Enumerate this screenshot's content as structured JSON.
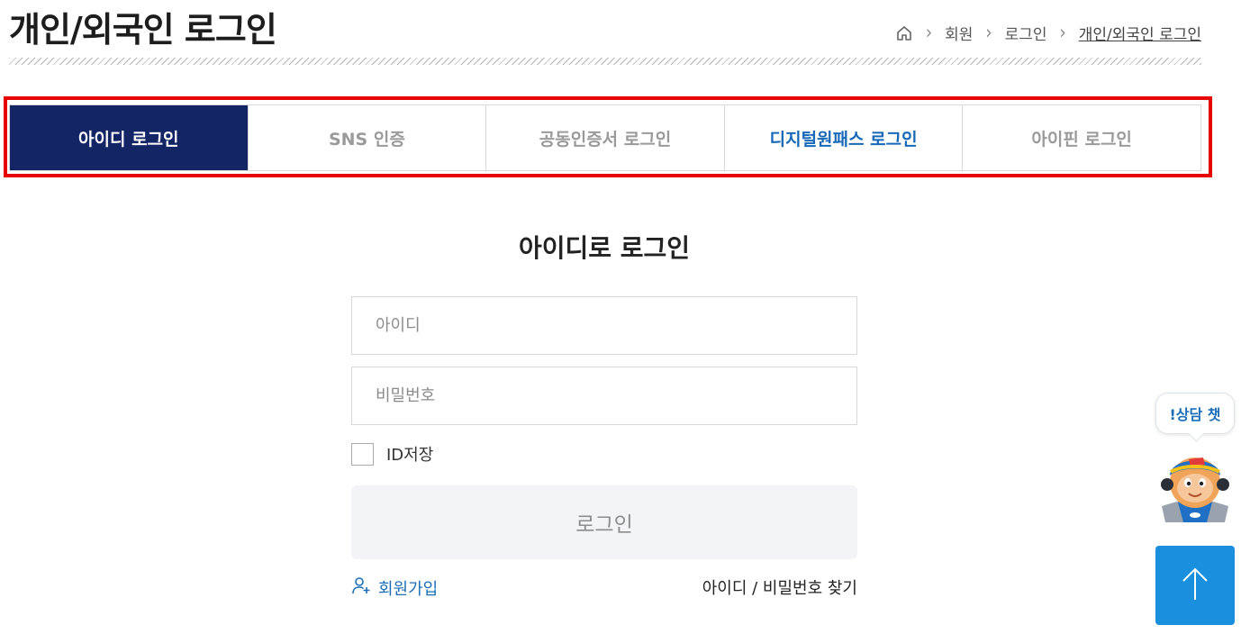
{
  "page": {
    "title": "개인/외국인 로그인"
  },
  "breadcrumb": {
    "items": [
      "회원",
      "로그인",
      "개인/외국인 로그인"
    ]
  },
  "tabs": [
    {
      "label": "아이디 로그인",
      "state": "active"
    },
    {
      "label": "SNS 인증"
    },
    {
      "label": "공동인증서 로그인"
    },
    {
      "label": "디지털원패스 로그인",
      "accent": "#1668b8"
    },
    {
      "label": "아이핀 로그인"
    }
  ],
  "login": {
    "heading": "아이디로 로그인",
    "id_placeholder": "아이디",
    "pw_placeholder": "비밀번호",
    "remember_label": "ID저장",
    "submit_label": "로그인",
    "signup_label": "회원가입",
    "find_label": "아이디 / 비밀번호 찾기"
  },
  "chatbot": {
    "label": "!상담  챗"
  },
  "colors": {
    "active_tab": "#132564",
    "highlight_frame": "#e60000",
    "link": "#1a6fb8",
    "top_button": "#1a8fde"
  },
  "icons": [
    "home-icon",
    "chevron-right-icon",
    "user-plus-icon",
    "arrow-up-icon",
    "chatbot-mascot-icon"
  ]
}
